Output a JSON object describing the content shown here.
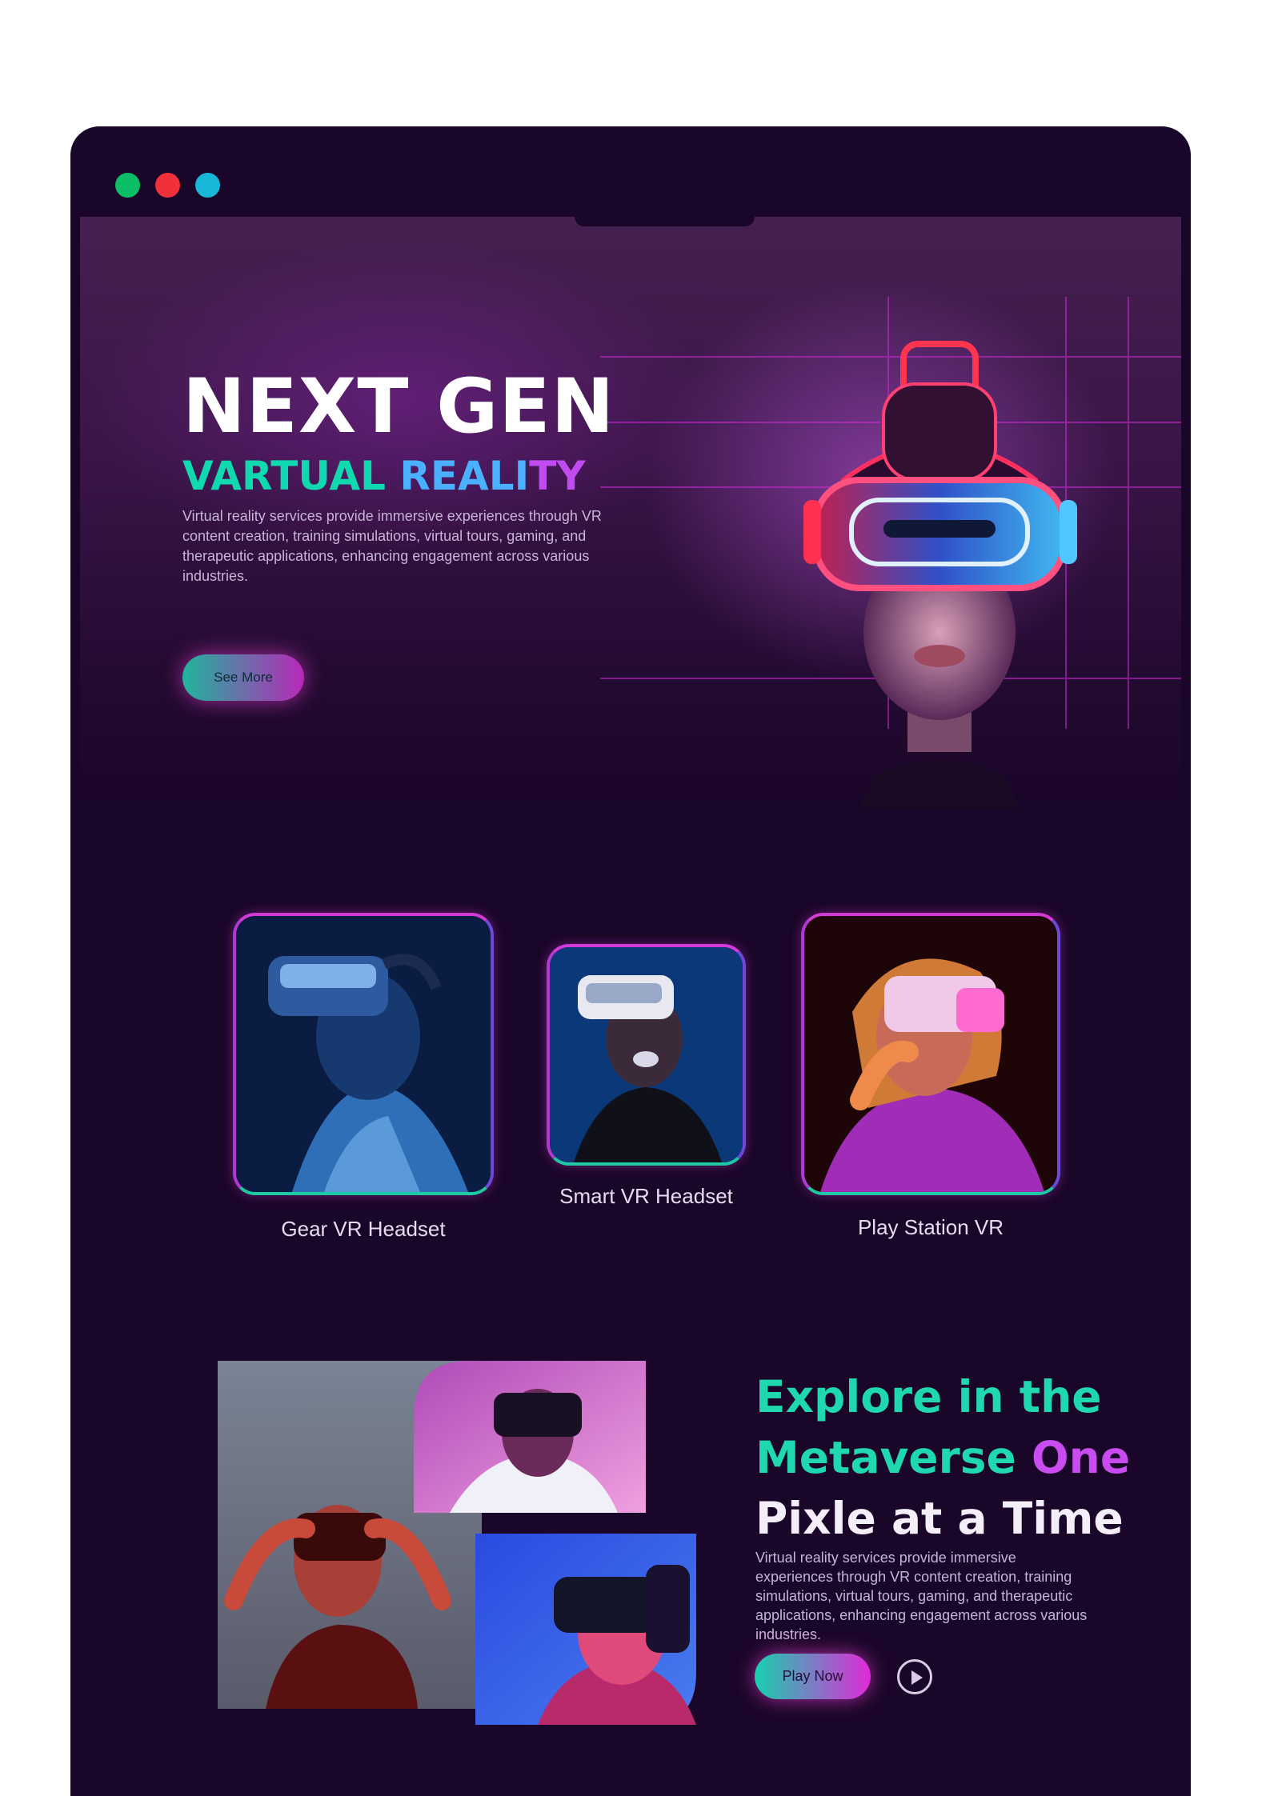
{
  "window": {
    "dots": [
      {
        "name": "green-dot",
        "color": "#0bbf66"
      },
      {
        "name": "red-dot",
        "color": "#f0303a"
      },
      {
        "name": "cyan-dot",
        "color": "#18b7d8"
      }
    ]
  },
  "hero": {
    "title": "NEXT GEN",
    "subtitle_part1": "VARTUAL ",
    "subtitle_part2": "REALI",
    "subtitle_part3": "TY",
    "description": "Virtual reality services provide immersive experiences through VR content creation, training simulations, virtual tours, gaming, and therapeutic applications, enhancing engagement across various industries.",
    "button_label": "See More"
  },
  "products": [
    {
      "label": "Gear VR Headset"
    },
    {
      "label": "Smart VR Headset"
    },
    {
      "label": "Play Station VR"
    }
  ],
  "explore": {
    "line1": "Explore in the",
    "line2a": "Metaverse ",
    "line2b": "One",
    "line3": "Pixle at a Time",
    "description": "Virtual reality services provide immersive experiences through VR content creation, training simulations, virtual tours, gaming, and therapeutic applications, enhancing engagement across various industries.",
    "button_label": "Play Now"
  },
  "colors": {
    "background": "#1a0628",
    "accent_teal": "#10d9b0",
    "accent_magenta": "#c84cf0",
    "accent_blue": "#4ab0ff"
  }
}
